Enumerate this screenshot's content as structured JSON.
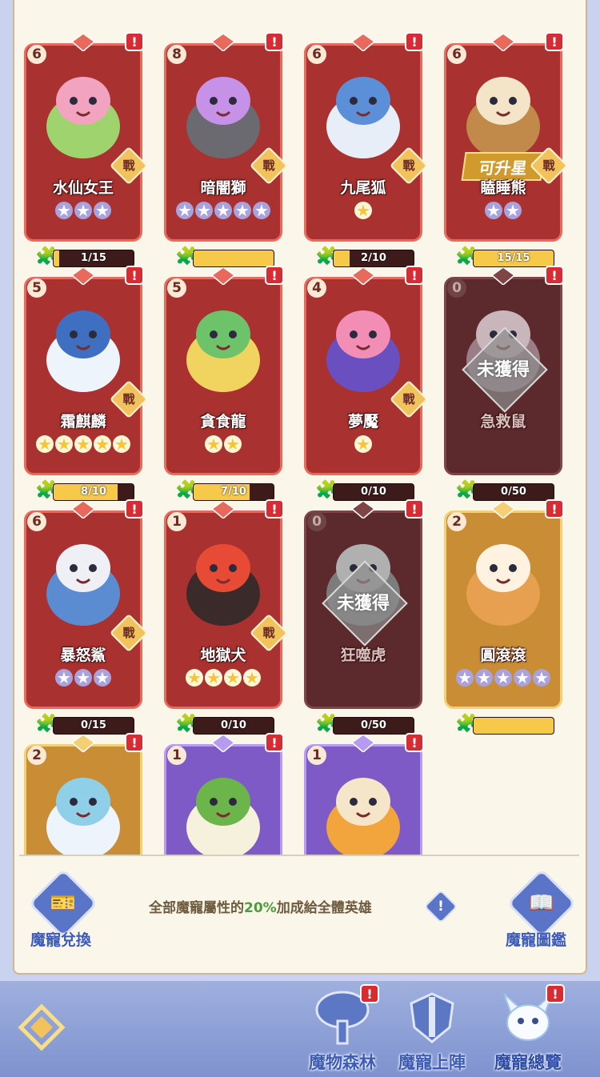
{
  "pets": [
    {
      "level": "6",
      "name": "水仙女王",
      "stars": 3,
      "star_color": "silver",
      "progress": "1/15",
      "fill": 0.07,
      "battle": "戰",
      "style": "red",
      "owned": true,
      "palette": [
        "#9fd36e",
        "#f2a3c0"
      ]
    },
    {
      "level": "8",
      "name": "暗闇獅",
      "stars": 5,
      "star_color": "silver",
      "progress": "",
      "fill": 1.0,
      "battle": "戰",
      "style": "red",
      "owned": true,
      "palette": [
        "#6a6a70",
        "#c592e8"
      ]
    },
    {
      "level": "6",
      "name": "九尾狐",
      "stars": 1,
      "star_color": "gold",
      "progress": "2/10",
      "fill": 0.2,
      "battle": "戰",
      "style": "red",
      "owned": true,
      "palette": [
        "#e8eef8",
        "#5b8fd8"
      ]
    },
    {
      "level": "6",
      "name": "瞌睡熊",
      "stars": 2,
      "star_color": "silver",
      "progress": "15/15",
      "fill": 1.0,
      "battle": "戰",
      "style": "red",
      "owned": true,
      "badge": "可升星",
      "palette": [
        "#c18a4a",
        "#f4e5c8"
      ]
    },
    {
      "level": "5",
      "name": "霜麒麟",
      "stars": 5,
      "star_color": "gold",
      "progress": "8/10",
      "fill": 0.8,
      "battle": "戰",
      "style": "red",
      "owned": true,
      "palette": [
        "#eef4fb",
        "#3e6fc0"
      ]
    },
    {
      "level": "5",
      "name": "貪食龍",
      "stars": 2,
      "star_color": "gold",
      "progress": "7/10",
      "fill": 0.7,
      "battle": "",
      "style": "red",
      "owned": true,
      "palette": [
        "#f1d460",
        "#6cc36a"
      ]
    },
    {
      "level": "4",
      "name": "夢魘",
      "stars": 1,
      "star_color": "gold",
      "progress": "0/10",
      "fill": 0,
      "battle": "戰",
      "style": "red",
      "owned": true,
      "palette": [
        "#6a4fc0",
        "#f28db6"
      ]
    },
    {
      "level": "0",
      "name": "急救鼠",
      "stars": 0,
      "star_color": "silver",
      "progress": "0/50",
      "fill": 0,
      "battle": "",
      "style": "locked",
      "owned": false,
      "palette": [
        "#9a7d86",
        "#c9b6bb"
      ]
    },
    {
      "level": "6",
      "name": "暴怒鯊",
      "stars": 3,
      "star_color": "silver",
      "progress": "0/15",
      "fill": 0,
      "battle": "戰",
      "style": "red",
      "owned": true,
      "palette": [
        "#5b8bd0",
        "#eef0f5"
      ]
    },
    {
      "level": "1",
      "name": "地獄犬",
      "stars": 4,
      "star_color": "gold",
      "progress": "0/10",
      "fill": 0,
      "battle": "戰",
      "style": "red",
      "owned": true,
      "palette": [
        "#3b2a2a",
        "#e74b35"
      ]
    },
    {
      "level": "0",
      "name": "狂噬虎",
      "stars": 0,
      "star_color": "silver",
      "progress": "0/50",
      "fill": 0,
      "battle": "",
      "style": "locked",
      "owned": false,
      "palette": [
        "#7c7c7c",
        "#b0b0b0"
      ]
    },
    {
      "level": "2",
      "name": "圓滾滾",
      "stars": 5,
      "star_color": "silver",
      "progress": "",
      "fill": 1.0,
      "battle": "",
      "style": "gold",
      "owned": true,
      "palette": [
        "#e6a04f",
        "#fff2e0"
      ]
    },
    {
      "level": "2",
      "name": "",
      "stars": 0,
      "star_color": "silver",
      "progress": "",
      "fill": 0,
      "battle": "",
      "style": "gold",
      "owned": true,
      "palette": [
        "#eef4fb",
        "#8fd0e8"
      ]
    },
    {
      "level": "1",
      "name": "",
      "stars": 0,
      "star_color": "silver",
      "progress": "",
      "fill": 0,
      "battle": "",
      "style": "purple",
      "owned": true,
      "palette": [
        "#f5f1dc",
        "#6cb54b"
      ]
    },
    {
      "level": "1",
      "name": "",
      "stars": 0,
      "star_color": "silver",
      "progress": "",
      "fill": 0,
      "battle": "",
      "style": "purple",
      "owned": true,
      "palette": [
        "#f2a53c",
        "#f5e6c9"
      ]
    }
  ],
  "alert_symbol": "!",
  "unowned_label": "未獲得",
  "info": {
    "exchange_label": "魔寵兌換",
    "catalog_label": "魔寵圖鑑",
    "text_before": "全部魔寵屬性的",
    "percent": "20%",
    "text_after": "加成給全體英雄",
    "info_symbol": "!"
  },
  "footer": {
    "forest_label": "魔物森林",
    "deploy_label": "魔寵上陣",
    "overview_label": "魔寵總覽"
  },
  "colors": {
    "panel_bg": "#fbf6ea",
    "accent_blue": "#3b5bb6",
    "alert_red": "#d62d35",
    "percent_green": "#4f9a3d"
  }
}
